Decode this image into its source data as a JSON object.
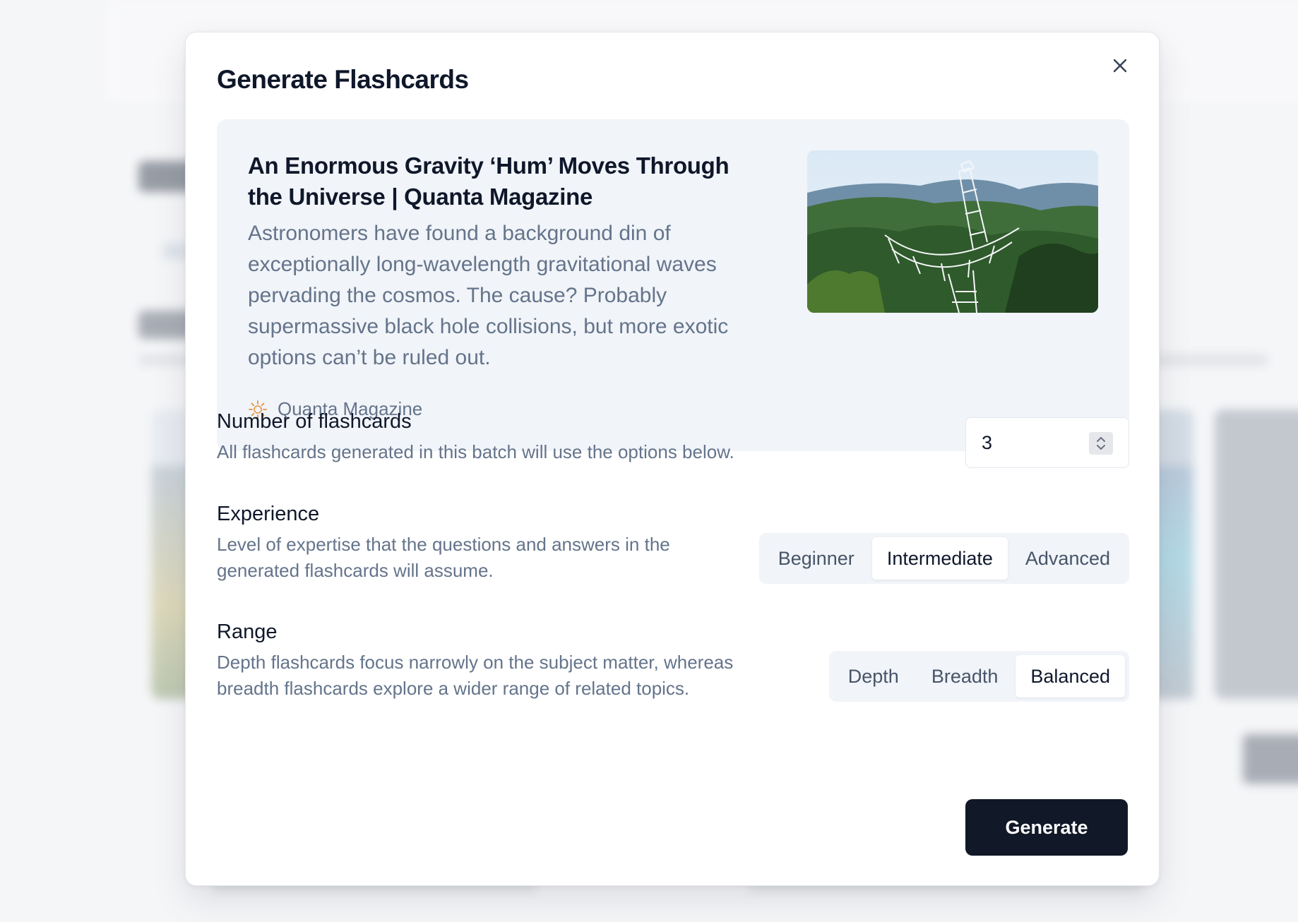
{
  "modal": {
    "title": "Generate Flashcards",
    "close_icon": "close-icon"
  },
  "article": {
    "title": "An Enormous Gravity ‘Hum’ Moves Through the Universe | Quanta Magazine",
    "description": "Astronomers have found a background din of exceptionally long-wavelength gravitational waves pervading the cosmos. The cause? Probably supermassive black hole collisions, but more exotic options can’t be ruled out.",
    "source": "Quanta Magazine",
    "source_icon": "quanta-logo-icon",
    "image_alt": "radio telescope in forested hills"
  },
  "settings": {
    "count": {
      "label": "Number of flashcards",
      "description": "All flashcards generated in this batch will use the options below.",
      "value": "3"
    },
    "experience": {
      "label": "Experience",
      "description": "Level of expertise that the questions and answers in the generated flashcards will assume.",
      "options": [
        "Beginner",
        "Intermediate",
        "Advanced"
      ],
      "selected": "Intermediate"
    },
    "range": {
      "label": "Range",
      "description": "Depth flashcards focus narrowly on the subject matter, whereas breadth flashcards explore a wider range of related topics.",
      "options": [
        "Depth",
        "Breadth",
        "Balanced"
      ],
      "selected": "Balanced"
    }
  },
  "actions": {
    "generate_label": "Generate"
  },
  "colors": {
    "primary_button": "#111827",
    "card_bg": "#f1f4f8",
    "muted_text": "#64748b",
    "source_icon": "#e8913a"
  }
}
